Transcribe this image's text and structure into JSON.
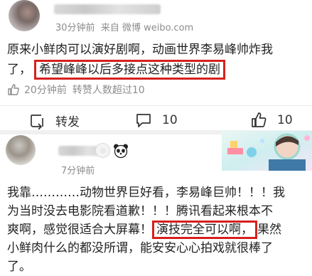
{
  "post1": {
    "time": "30分钟前",
    "source": "来自 微博 weibo.com",
    "line1": "原来小鲜肉可以演好剧啊，动画世界李易峰帅炸我",
    "line2_prefix": "了，",
    "line2_highlight": "希望峰峰以后多接点这种类型的剧",
    "stats_time": "20分钟前",
    "stats_reposts": "转赞人数超过10"
  },
  "actions": {
    "repost_label": "转发",
    "comment_count": "10",
    "like_count": "10"
  },
  "post2": {
    "time": "7分钟前",
    "line1": "我靠…………动物世界巨好看，李易峰巨帅！！！我",
    "line2": "为当时没去电影院看道歉！！！腾讯看起来根本不",
    "line3_prefix": "爽啊，感觉很适合大屏幕！",
    "line3_highlight": "演技完全可以啊，",
    "line3_suffix": "果然",
    "line4": "小鲜肉什么的都没所谓，能安安心心拍戏就很棒了",
    "line5": "了。"
  },
  "colors": {
    "highlight_border": "#d6201f",
    "meta_text": "#8c8c8c"
  },
  "icons": {
    "stats": "thumbs-up-icon",
    "repost": "repost-icon",
    "comment": "comment-icon",
    "like": "like-icon",
    "emoji": "panda-icon"
  }
}
